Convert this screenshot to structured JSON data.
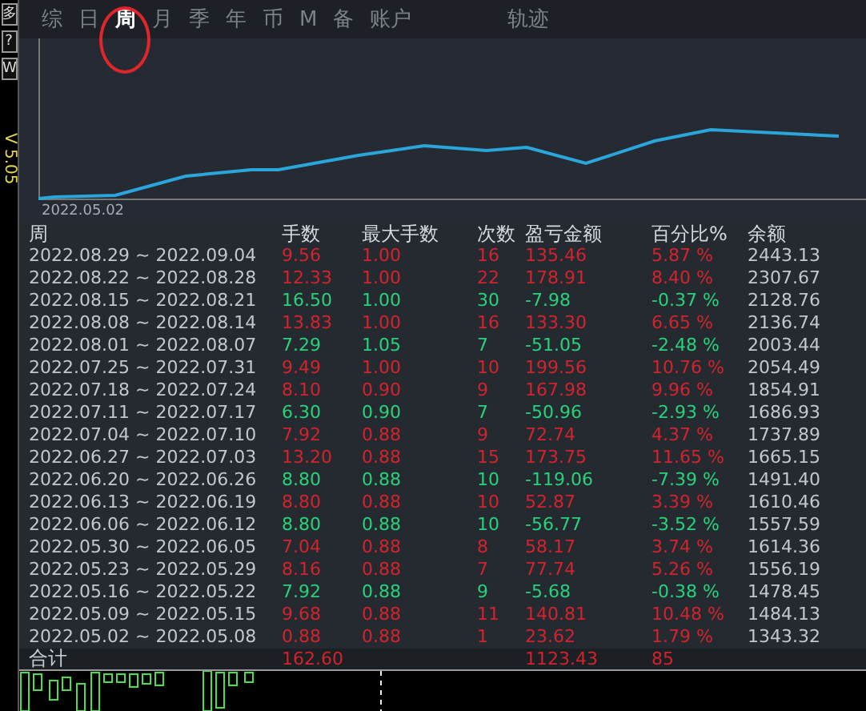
{
  "side_buttons": [
    "多",
    "?",
    "W"
  ],
  "version": "V 5.05",
  "tabs": [
    {
      "label": "综",
      "selected": false
    },
    {
      "label": "日",
      "selected": false
    },
    {
      "label": "周",
      "selected": true
    },
    {
      "label": "月",
      "selected": false
    },
    {
      "label": "季",
      "selected": false
    },
    {
      "label": "年",
      "selected": false
    },
    {
      "label": "币",
      "selected": false
    },
    {
      "label": "M",
      "selected": false
    },
    {
      "label": "备",
      "selected": false
    },
    {
      "label": "账户",
      "selected": false
    },
    {
      "label": "轨迹",
      "selected": false
    }
  ],
  "chart": {
    "start_label": "2022.05.02"
  },
  "table": {
    "columns": [
      "周",
      "手数",
      "最大手数",
      "次数",
      "盈亏金额",
      "百分比%",
      "余额"
    ],
    "rows": [
      {
        "kind": "profit",
        "cells": [
          "2022.08.29 ~ 2022.09.04",
          "9.56",
          "1.00",
          "16",
          "135.46",
          "5.87 %",
          "2443.13"
        ]
      },
      {
        "kind": "profit",
        "cells": [
          "2022.08.22 ~ 2022.08.28",
          "12.33",
          "1.00",
          "22",
          "178.91",
          "8.40 %",
          "2307.67"
        ]
      },
      {
        "kind": "loss",
        "cells": [
          "2022.08.15 ~ 2022.08.21",
          "16.50",
          "1.00",
          "30",
          "-7.98",
          "-0.37 %",
          "2128.76"
        ]
      },
      {
        "kind": "profit",
        "cells": [
          "2022.08.08 ~ 2022.08.14",
          "13.83",
          "1.00",
          "16",
          "133.30",
          "6.65 %",
          "2136.74"
        ]
      },
      {
        "kind": "loss",
        "cells": [
          "2022.08.01 ~ 2022.08.07",
          "7.29",
          "1.05",
          "7",
          "-51.05",
          "-2.48 %",
          "2003.44"
        ]
      },
      {
        "kind": "profit",
        "cells": [
          "2022.07.25 ~ 2022.07.31",
          "9.49",
          "1.00",
          "10",
          "199.56",
          "10.76 %",
          "2054.49"
        ]
      },
      {
        "kind": "profit",
        "cells": [
          "2022.07.18 ~ 2022.07.24",
          "8.10",
          "0.90",
          "9",
          "167.98",
          "9.96 %",
          "1854.91"
        ]
      },
      {
        "kind": "loss",
        "cells": [
          "2022.07.11 ~ 2022.07.17",
          "6.30",
          "0.90",
          "7",
          "-50.96",
          "-2.93 %",
          "1686.93"
        ]
      },
      {
        "kind": "profit",
        "cells": [
          "2022.07.04 ~ 2022.07.10",
          "7.92",
          "0.88",
          "9",
          "72.74",
          "4.37 %",
          "1737.89"
        ]
      },
      {
        "kind": "profit",
        "cells": [
          "2022.06.27 ~ 2022.07.03",
          "13.20",
          "0.88",
          "15",
          "173.75",
          "11.65 %",
          "1665.15"
        ]
      },
      {
        "kind": "loss",
        "cells": [
          "2022.06.20 ~ 2022.06.26",
          "8.80",
          "0.88",
          "10",
          "-119.06",
          "-7.39 %",
          "1491.40"
        ]
      },
      {
        "kind": "profit",
        "cells": [
          "2022.06.13 ~ 2022.06.19",
          "8.80",
          "0.88",
          "10",
          "52.87",
          "3.39 %",
          "1610.46"
        ]
      },
      {
        "kind": "loss",
        "cells": [
          "2022.06.06 ~ 2022.06.12",
          "8.80",
          "0.88",
          "10",
          "-56.77",
          "-3.52 %",
          "1557.59"
        ]
      },
      {
        "kind": "profit",
        "cells": [
          "2022.05.30 ~ 2022.06.05",
          "7.04",
          "0.88",
          "8",
          "58.17",
          "3.74 %",
          "1614.36"
        ]
      },
      {
        "kind": "profit",
        "cells": [
          "2022.05.23 ~ 2022.05.29",
          "8.16",
          "0.88",
          "7",
          "77.74",
          "5.26 %",
          "1556.19"
        ]
      },
      {
        "kind": "loss",
        "cells": [
          "2022.05.16 ~ 2022.05.22",
          "7.92",
          "0.88",
          "9",
          "-5.68",
          "-0.38 %",
          "1478.45"
        ]
      },
      {
        "kind": "profit",
        "cells": [
          "2022.05.09 ~ 2022.05.15",
          "9.68",
          "0.88",
          "11",
          "140.81",
          "10.48 %",
          "1484.13"
        ]
      },
      {
        "kind": "profit",
        "cells": [
          "2022.05.02 ~ 2022.05.08",
          "0.88",
          "0.88",
          "1",
          "23.62",
          "1.79 %",
          "1343.32"
        ]
      }
    ],
    "total": {
      "kind": "profit",
      "label": "合计",
      "lots": "162.60",
      "amount": "1123.43",
      "percent": "85"
    }
  }
}
